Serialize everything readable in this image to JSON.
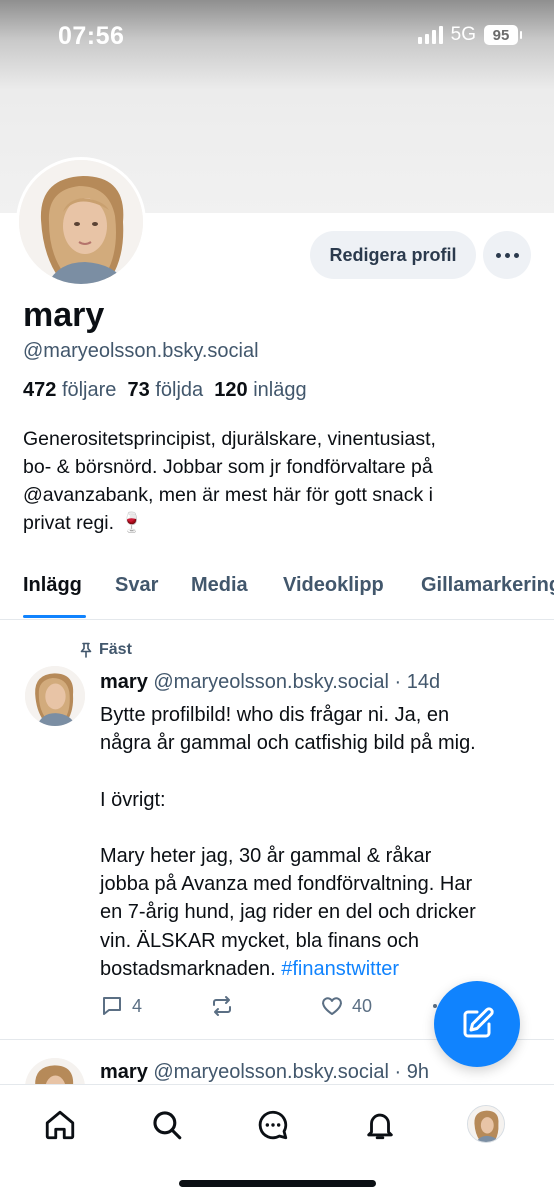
{
  "status_bar": {
    "time": "07:56",
    "network": "5G",
    "battery": "95"
  },
  "profile": {
    "edit_label": "Redigera profil",
    "display_name": "mary",
    "handle": "@maryeolsson.bsky.social",
    "stats": {
      "followers_count": "472",
      "followers_label": "följare",
      "following_count": "73",
      "following_label": "följda",
      "posts_count": "120",
      "posts_label": "inlägg"
    },
    "bio_lines": [
      "Generositetsprincipist, djurälskare, vinentusiast,",
      "bo- & börsnörd. Jobbar som jr fondförvaltare på",
      "@avanzabank, men är mest här för gott snack i",
      "privat regi. 🍷"
    ]
  },
  "tabs": [
    "Inlägg",
    "Svar",
    "Media",
    "Videoklipp",
    "Gillamarkeringar"
  ],
  "pinned_label": "Fäst",
  "post": {
    "author": "mary",
    "handle": "@maryeolsson.bsky.social",
    "time": "· 14d",
    "lines": [
      "Bytte profilbild! who dis frågar ni. Ja, en",
      "några år gammal och catfishig bild på mig.",
      "",
      "I övrigt:",
      "",
      "Mary heter jag, 30 år gammal & råkar",
      "jobba på Avanza med fondförvaltning. Har",
      "en 7-årig hund, jag rider en del och dricker",
      "vin. ÄLSKAR mycket, bla finans och",
      "bostadsmarknaden."
    ],
    "hashtag": "#finanstwitter",
    "reply_count": "4",
    "like_count": "40"
  },
  "post2": {
    "author": "mary",
    "handle": "@maryeolsson.bsky.social",
    "time": "· 9h"
  },
  "colors": {
    "accent": "#1083fe",
    "muted": "#42576c",
    "button_bg": "#eef1f5"
  },
  "icons": {
    "nav": [
      "home-icon",
      "search-icon",
      "chat-icon",
      "bell-icon",
      "profile-avatar"
    ],
    "actions": [
      "reply-icon",
      "repost-icon",
      "like-icon",
      "more-icon"
    ],
    "fab": "compose-icon",
    "pinned": "pin-icon"
  }
}
